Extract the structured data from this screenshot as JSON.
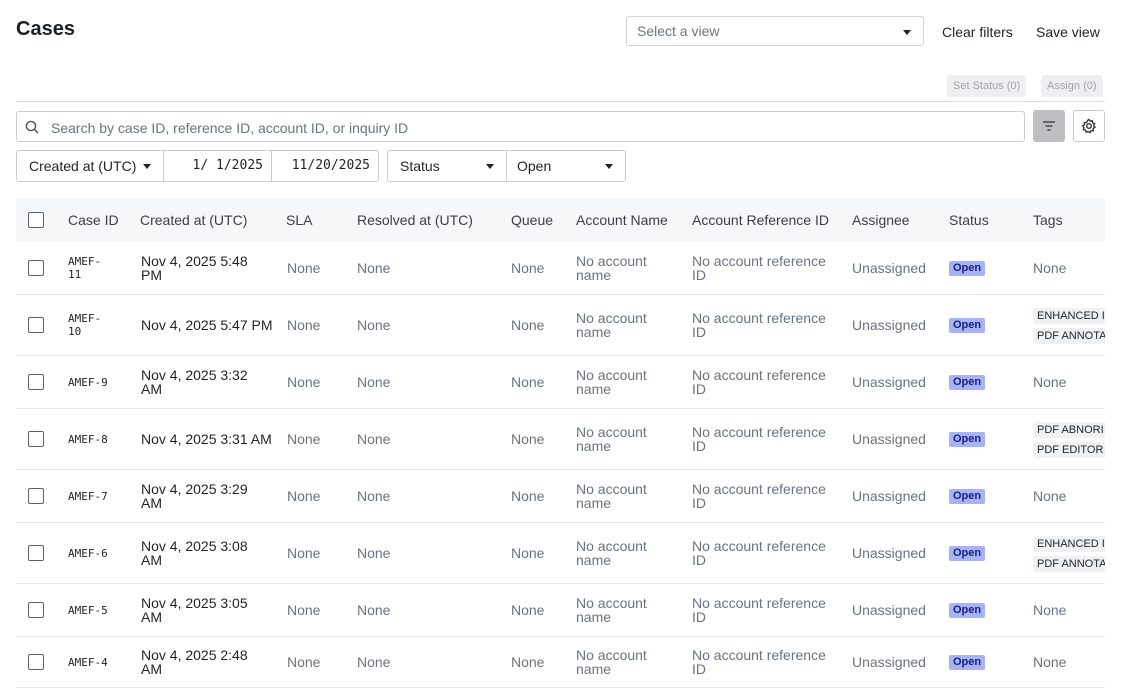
{
  "page": {
    "title": "Cases"
  },
  "toolbar": {
    "view_placeholder": "Select a view",
    "clear_filters": "Clear filters",
    "save_view": "Save view",
    "set_status": "Set Status (0)",
    "assign": "Assign (0)"
  },
  "search": {
    "placeholder": "Search by case ID, reference ID, account ID, or inquiry ID"
  },
  "filters": {
    "date_field": "Created at (UTC)",
    "start_date": "1/ 1/2025",
    "end_date": "11/20/2025",
    "status_field": "Status",
    "status_value": "Open"
  },
  "table": {
    "columns": [
      "Case ID",
      "Created at (UTC)",
      "SLA",
      "Resolved at (UTC)",
      "Queue",
      "Account Name",
      "Account Reference ID",
      "Assignee",
      "Status",
      "Tags"
    ],
    "rows": [
      {
        "id_l1": "AMEF-",
        "id_l2": "11",
        "created_l1": "Nov 4, 2025 5:48",
        "created_l2": "PM",
        "sla": "None",
        "resolved": "None",
        "queue": "None",
        "account_l1": "No account",
        "account_l2": "name",
        "ref_l1": "No account reference",
        "ref_l2": "ID",
        "assignee": "Unassigned",
        "status": "Open",
        "tags": [],
        "tags_empty": "None"
      },
      {
        "id_l1": "AMEF-",
        "id_l2": "10",
        "created_l1": "Nov 4, 2025 5:47 PM",
        "created_l2": "",
        "sla": "None",
        "resolved": "None",
        "queue": "None",
        "account_l1": "No account",
        "account_l2": "name",
        "ref_l1": "No account reference",
        "ref_l2": "ID",
        "assignee": "Unassigned",
        "status": "Open",
        "tags": [
          "ENHANCED I",
          "PDF ANNOTA"
        ],
        "tags_empty": ""
      },
      {
        "id_l1": "AMEF-9",
        "id_l2": "",
        "created_l1": "Nov 4, 2025 3:32",
        "created_l2": "AM",
        "sla": "None",
        "resolved": "None",
        "queue": "None",
        "account_l1": "No account",
        "account_l2": "name",
        "ref_l1": "No account reference",
        "ref_l2": "ID",
        "assignee": "Unassigned",
        "status": "Open",
        "tags": [],
        "tags_empty": "None"
      },
      {
        "id_l1": "AMEF-8",
        "id_l2": "",
        "created_l1": "Nov 4, 2025 3:31 AM",
        "created_l2": "",
        "sla": "None",
        "resolved": "None",
        "queue": "None",
        "account_l1": "No account",
        "account_l2": "name",
        "ref_l1": "No account reference",
        "ref_l2": "ID",
        "assignee": "Unassigned",
        "status": "Open",
        "tags": [
          "PDF ABNORI",
          "PDF EDITOR"
        ],
        "tags_empty": ""
      },
      {
        "id_l1": "AMEF-7",
        "id_l2": "",
        "created_l1": "Nov 4, 2025 3:29",
        "created_l2": "AM",
        "sla": "None",
        "resolved": "None",
        "queue": "None",
        "account_l1": "No account",
        "account_l2": "name",
        "ref_l1": "No account reference",
        "ref_l2": "ID",
        "assignee": "Unassigned",
        "status": "Open",
        "tags": [],
        "tags_empty": "None"
      },
      {
        "id_l1": "AMEF-6",
        "id_l2": "",
        "created_l1": "Nov 4, 2025 3:08",
        "created_l2": "AM",
        "sla": "None",
        "resolved": "None",
        "queue": "None",
        "account_l1": "No account",
        "account_l2": "name",
        "ref_l1": "No account reference",
        "ref_l2": "ID",
        "assignee": "Unassigned",
        "status": "Open",
        "tags": [
          "ENHANCED I",
          "PDF ANNOTA"
        ],
        "tags_empty": ""
      },
      {
        "id_l1": "AMEF-5",
        "id_l2": "",
        "created_l1": "Nov 4, 2025 3:05",
        "created_l2": "AM",
        "sla": "None",
        "resolved": "None",
        "queue": "None",
        "account_l1": "No account",
        "account_l2": "name",
        "ref_l1": "No account reference",
        "ref_l2": "ID",
        "assignee": "Unassigned",
        "status": "Open",
        "tags": [],
        "tags_empty": "None"
      },
      {
        "id_l1": "AMEF-4",
        "id_l2": "",
        "created_l1": "Nov 4, 2025 2:48",
        "created_l2": "AM",
        "sla": "None",
        "resolved": "None",
        "queue": "None",
        "account_l1": "No account",
        "account_l2": "name",
        "ref_l1": "No account reference",
        "ref_l2": "ID",
        "assignee": "Unassigned",
        "status": "Open",
        "tags": [],
        "tags_empty": "None"
      }
    ]
  },
  "colors": {
    "status_badge_bg": "#a8b3f5",
    "status_badge_text": "#1a2080",
    "filter_active_bg": "#bdbfc2"
  },
  "icons": {
    "search": "search-icon",
    "filter": "filter-lines-icon",
    "settings": "gear-icon",
    "dropdown": "caret-down-icon"
  }
}
